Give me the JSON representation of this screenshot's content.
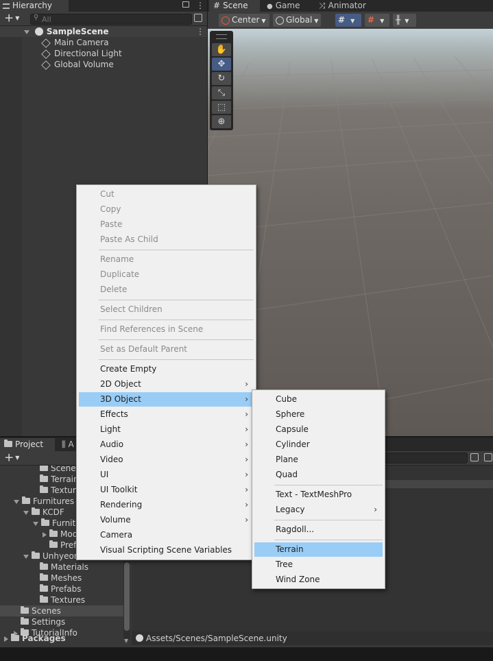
{
  "hierarchy": {
    "tab_label": "Hierarchy",
    "search_placeholder": "All",
    "scene_name": "SampleScene",
    "objects": [
      "Main Camera",
      "Directional Light",
      "Global Volume"
    ]
  },
  "scene_view": {
    "tabs": [
      "Scene",
      "Game",
      "Animator"
    ],
    "pivot_mode": "Center",
    "pivot_rotation": "Global"
  },
  "project": {
    "tab_label": "Project",
    "tab2_label": "A",
    "tree": [
      {
        "label": "Scene",
        "indent": 3
      },
      {
        "label": "Terrain",
        "indent": 3
      },
      {
        "label": "Textur",
        "indent": 3
      },
      {
        "label": "Furnitures",
        "indent": 1
      },
      {
        "label": "KCDF",
        "indent": 2
      },
      {
        "label": "Furnitu",
        "indent": 3
      },
      {
        "label": "Mod",
        "indent": 4
      },
      {
        "label": "Pref",
        "indent": 4
      },
      {
        "label": "Unhyeon",
        "indent": 2
      },
      {
        "label": "Materials",
        "indent": 3
      },
      {
        "label": "Meshes",
        "indent": 3
      },
      {
        "label": "Prefabs",
        "indent": 3
      },
      {
        "label": "Textures",
        "indent": 3
      },
      {
        "label": "Scenes",
        "indent": 1
      },
      {
        "label": "Settings",
        "indent": 1
      },
      {
        "label": "TutorialInfo",
        "indent": 1
      }
    ],
    "packages_label": "Packages",
    "path": "Assets/Scenes/SampleScene.unity"
  },
  "context_menu": {
    "items": [
      {
        "label": "Cut",
        "disabled": true
      },
      {
        "label": "Copy",
        "disabled": true
      },
      {
        "label": "Paste",
        "disabled": true
      },
      {
        "label": "Paste As Child",
        "disabled": true
      },
      {
        "label": "Rename",
        "disabled": true
      },
      {
        "label": "Duplicate",
        "disabled": true
      },
      {
        "label": "Delete",
        "disabled": true
      },
      {
        "label": "Select Children",
        "disabled": true
      },
      {
        "label": "Find References in Scene",
        "disabled": true
      },
      {
        "label": "Set as Default Parent",
        "disabled": true
      },
      {
        "label": "Create Empty"
      },
      {
        "label": "2D Object",
        "submenu": true
      },
      {
        "label": "3D Object",
        "submenu": true,
        "highlighted": true
      },
      {
        "label": "Effects",
        "submenu": true
      },
      {
        "label": "Light",
        "submenu": true
      },
      {
        "label": "Audio",
        "submenu": true
      },
      {
        "label": "Video",
        "submenu": true
      },
      {
        "label": "UI",
        "submenu": true
      },
      {
        "label": "UI Toolkit",
        "submenu": true
      },
      {
        "label": "Rendering",
        "submenu": true
      },
      {
        "label": "Volume",
        "submenu": true
      },
      {
        "label": "Camera"
      },
      {
        "label": "Visual Scripting Scene Variables"
      }
    ]
  },
  "submenu_3d": {
    "items": [
      {
        "label": "Cube"
      },
      {
        "label": "Sphere"
      },
      {
        "label": "Capsule"
      },
      {
        "label": "Cylinder"
      },
      {
        "label": "Plane"
      },
      {
        "label": "Quad"
      },
      {
        "label": "Text - TextMeshPro"
      },
      {
        "label": "Legacy",
        "submenu": true
      },
      {
        "label": "Ragdoll..."
      },
      {
        "label": "Terrain",
        "highlighted": true
      },
      {
        "label": "Tree"
      },
      {
        "label": "Wind Zone"
      }
    ]
  },
  "colors": {
    "menu_bg": "#f0f0f0",
    "menu_highlight": "#99cdf6",
    "panel_bg": "#383838",
    "active_tool": "#465c85"
  }
}
